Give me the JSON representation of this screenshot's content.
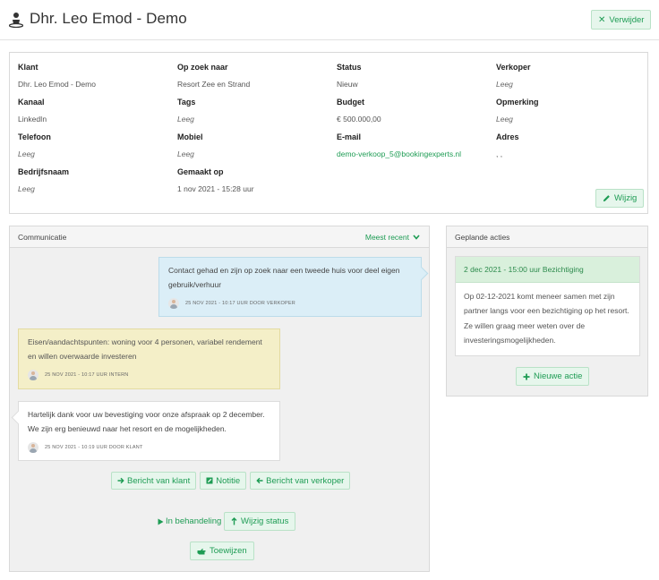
{
  "header": {
    "title": "Dhr. Leo Emod - Demo",
    "delete_label": "Verwijder"
  },
  "details": {
    "fields": [
      {
        "label": "Klant",
        "value": "Dhr. Leo Emod - Demo"
      },
      {
        "label": "Op zoek naar",
        "value": "Resort Zee en Strand"
      },
      {
        "label": "Status",
        "value": "Nieuw"
      },
      {
        "label": "Verkoper",
        "value": "Leeg"
      },
      {
        "label": "Kanaal",
        "value": "LinkedIn"
      },
      {
        "label": "Tags",
        "value": "Leeg"
      },
      {
        "label": "Budget",
        "value": "€ 500.000,00"
      },
      {
        "label": "Opmerking",
        "value": "Leeg"
      },
      {
        "label": "Telefoon",
        "value": "Leeg"
      },
      {
        "label": "Mobiel",
        "value": "Leeg"
      },
      {
        "label": "E-mail",
        "value": "demo-verkoop_5@bookingexperts.nl"
      },
      {
        "label": "Adres",
        "value": ", ,"
      },
      {
        "label": "Bedrijfsnaam",
        "value": "Leeg"
      },
      {
        "label": "Gemaakt op",
        "value": "1 nov 2021 - 15:28 uur"
      }
    ],
    "edit_label": "Wijzig"
  },
  "communication": {
    "title": "Communicatie",
    "sort_label": "Meest recent",
    "messages": [
      {
        "text": "Contact gehad en zijn op zoek naar een tweede huis voor deel eigen gebruik/verhuur",
        "meta": "25 NOV 2021 - 10:17 UUR DOOR VERKOPER"
      },
      {
        "text": "Eisen/aandachtspunten: woning voor 4 personen, variabel rendement en willen overwaarde investeren",
        "meta": "25 NOV 2021 - 10:17 UUR INTERN"
      },
      {
        "text": "Hartelijk dank voor uw bevestiging voor onze afspraak op 2 december. We zijn erg benieuwd naar het resort en de mogelijkheden.",
        "meta": "25 NOV 2021 - 10:19 UUR DOOR KLANT"
      }
    ],
    "buttons": {
      "from_client": "Bericht van klant",
      "note": "Notitie",
      "from_seller": "Bericht van verkoper"
    },
    "status_label": "In behandeling",
    "change_status_label": "Wijzig status",
    "assign_label": "Toewijzen"
  },
  "planned": {
    "title": "Geplande acties",
    "task_title": "2 dec 2021 - 15:00 uur Bezichtiging",
    "task_body": "Op 02-12-2021 komt meneer samen met zijn partner langs voor een bezichtiging op het resort. Ze willen graag meer weten over de investeringsmogelijkheden.",
    "new_action_label": "Nieuwe actie"
  },
  "colors": {
    "accent": "#1e9c54",
    "seller_bubble": "#dbeef7",
    "note_bubble": "#f4efc8",
    "task_header": "#d9f0dc"
  }
}
